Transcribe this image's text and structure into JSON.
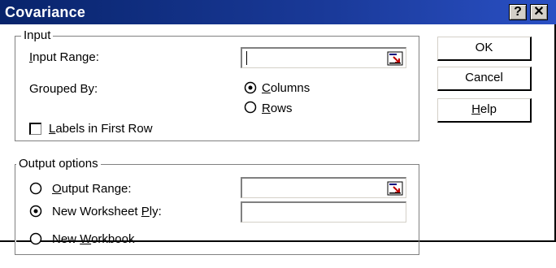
{
  "window": {
    "title": "Covariance",
    "help_glyph": "?",
    "close_glyph": "✕"
  },
  "input": {
    "group_label": "Input",
    "range": {
      "label_prefix": "",
      "label_accel": "I",
      "label_rest": "nput Range:",
      "value": ""
    },
    "grouped_by": {
      "label": "Grouped By:",
      "options": [
        {
          "accel": "C",
          "rest": "olumns",
          "selected": true
        },
        {
          "accel": "R",
          "rest": "ows",
          "selected": false
        }
      ]
    },
    "labels_first_row": {
      "accel": "L",
      "rest": "abels in First Row",
      "checked": false
    }
  },
  "output": {
    "group_label": "Output options",
    "options": [
      {
        "accel": "O",
        "rest": "utput Range:",
        "pre": "",
        "selected": false,
        "value": ""
      },
      {
        "pre": "New Worksheet ",
        "accel": "P",
        "rest": "ly:",
        "selected": true,
        "value": ""
      },
      {
        "pre": "New ",
        "accel": "W",
        "rest": "orkbook",
        "selected": false
      }
    ]
  },
  "buttons": {
    "ok": "OK",
    "cancel": "Cancel",
    "help_accel": "H",
    "help_rest": "elp"
  },
  "colors": {
    "titlebar": "#08246b",
    "title_text": "#ffffff"
  }
}
